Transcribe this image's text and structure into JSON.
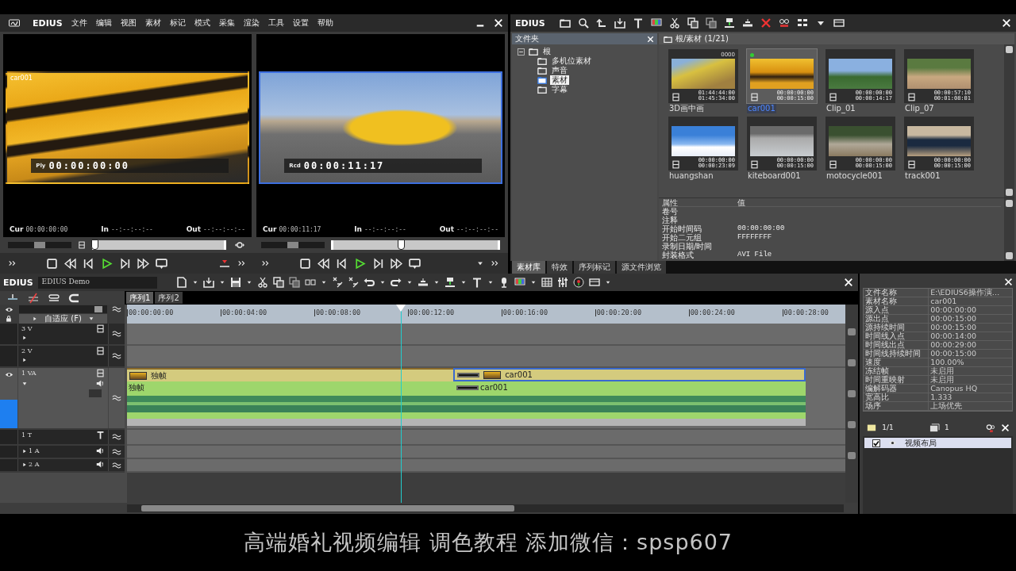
{
  "player_window": {
    "title": "EDIUS",
    "menu": [
      "文件",
      "编辑",
      "视图",
      "素材",
      "标记",
      "模式",
      "采集",
      "渲染",
      "工具",
      "设置",
      "帮助"
    ],
    "monitors": [
      {
        "kind": "player",
        "selected": false,
        "clip_name": "car001",
        "mode": "Ply",
        "timecode": "00:00:00:00",
        "fields": [
          {
            "label": "Cur",
            "value": "00:00:00:00"
          },
          {
            "label": "In",
            "value": "--:--:--:--"
          },
          {
            "label": "Out",
            "value": "--:--:--:--"
          }
        ],
        "shuttle": {
          "level": 0.5
        },
        "level": 0.0
      },
      {
        "kind": "recorder",
        "selected": true,
        "mode": "Rcd",
        "timecode": "00:00:11:17",
        "fields": [
          {
            "label": "Cur",
            "value": "00:00:11:17"
          },
          {
            "label": "In",
            "value": "--:--:--:--"
          },
          {
            "label": "Out",
            "value": "--:--:--:--"
          }
        ],
        "shuttle": {
          "level": 0.5
        },
        "level": 0.41
      }
    ]
  },
  "bin_window": {
    "title": "EDIUS",
    "folder_pane": {
      "title": "文件夹",
      "tree": [
        {
          "label": "根",
          "expanded": true,
          "selected": false,
          "children": [
            {
              "label": "多机位素材",
              "selected": false
            },
            {
              "label": "声音",
              "selected": false
            },
            {
              "label": "素材",
              "selected": true
            },
            {
              "label": "字幕",
              "selected": false
            }
          ]
        }
      ]
    },
    "path": "根/素材 (1/21)",
    "clips": [
      {
        "name": "3D画中画",
        "badge": "0000",
        "in": "01:44:44:00",
        "out": "01:45:34:00",
        "used": false,
        "selected": false
      },
      {
        "name": "car001",
        "in": "00:00:00:00",
        "out": "00:00:15:00",
        "used": true,
        "selected": true
      },
      {
        "name": "Clip_01",
        "in": "00:00:00:00",
        "out": "00:00:14:17",
        "used": false,
        "selected": false
      },
      {
        "name": "Clip_07",
        "in": "00:00:57:10",
        "out": "00:01:08:01",
        "used": false,
        "selected": false
      },
      {
        "name": "huangshan",
        "in": "00:00:00:00",
        "out": "00:00:23:09",
        "used": false,
        "selected": false
      },
      {
        "name": "kiteboard001",
        "in": "00:00:00:00",
        "out": "00:00:15:00",
        "used": false,
        "selected": false
      },
      {
        "name": "motocycle001",
        "in": "00:00:00:00",
        "out": "00:00:15:00",
        "used": false,
        "selected": false
      },
      {
        "name": "track001",
        "in": "00:00:00:00",
        "out": "00:00:15:00",
        "used": false,
        "selected": false
      }
    ],
    "properties": {
      "columns": [
        "属性",
        "值"
      ],
      "rows": [
        {
          "name": "卷号"
        },
        {
          "name": "注释"
        },
        {
          "name": "开始时间码",
          "value": "00:00:00:00"
        },
        {
          "name": "开始二元组",
          "value": "FFFFFFFF"
        },
        {
          "name": "录制日期/时间"
        },
        {
          "name": "封装格式",
          "value": "AVI File"
        }
      ]
    },
    "tabs": [
      {
        "label": "素材库",
        "selected": true
      },
      {
        "label": "特效",
        "selected": false
      },
      {
        "label": "序列标记",
        "selected": false
      },
      {
        "label": "源文件浏览",
        "selected": false
      }
    ]
  },
  "timeline": {
    "title": "EDIUS",
    "project": "EDIUS Demo",
    "sequences": [
      {
        "label": "序列1",
        "selected": true
      },
      {
        "label": "序列2",
        "selected": false
      }
    ],
    "zoom": "自适应 (F)",
    "zoom_slider": {
      "level": 0.95
    },
    "ruler": [
      "00:00:00:00",
      "00:00:04:00",
      "00:00:08:00",
      "00:00:12:00",
      "00:00:16:00",
      "00:00:20:00",
      "00:00:24:00",
      "00:00:28:00"
    ],
    "playhead": {
      "level": 0.381
    },
    "tracks": [
      {
        "label": "3 V",
        "kind": "video",
        "patched": false
      },
      {
        "label": "2 V",
        "kind": "video",
        "patched": false
      },
      {
        "label": "1 VA",
        "kind": "va",
        "patched": true,
        "video_clips": [
          {
            "name": "独帧",
            "selected": false
          },
          {
            "name": "car001",
            "selected": true
          }
        ],
        "audio_clips": [
          {
            "name": "独帧"
          },
          {
            "name": "car001"
          }
        ]
      },
      {
        "label": "1 T",
        "kind": "title",
        "patched": false
      },
      {
        "label": "1 A",
        "kind": "audio",
        "patched": false
      },
      {
        "label": "2 A",
        "kind": "audio",
        "patched": false
      }
    ]
  },
  "info_panel": {
    "rows": [
      {
        "name": "文件名称",
        "value": "E:\\EDIUS6操作演…"
      },
      {
        "name": "素材名称",
        "value": "car001"
      },
      {
        "name": "源入点",
        "value": "00:00:00:00"
      },
      {
        "name": "源出点",
        "value": "00:00:15:00"
      },
      {
        "name": "源持续时间",
        "value": "00:00:15:00"
      },
      {
        "name": "时间线入点",
        "value": "00:00:14:00"
      },
      {
        "name": "时间线出点",
        "value": "00:00:29:00"
      },
      {
        "name": "时间线持续时间",
        "value": "00:00:15:00"
      },
      {
        "name": "速度",
        "value": "100.00%"
      },
      {
        "name": "冻结帧",
        "value": "未启用"
      },
      {
        "name": "时间重映射",
        "value": "未启用"
      },
      {
        "name": "编解码器",
        "value": "Canopus HQ"
      },
      {
        "name": "宽高比",
        "value": "1.333"
      },
      {
        "name": "场序",
        "value": "上场优先"
      }
    ],
    "layers": {
      "page": "1/1",
      "count": "1",
      "items": [
        {
          "label": "视频布局",
          "checked": true
        }
      ]
    }
  },
  "caption": "高端婚礼视频编辑 调色教程 添加微信：spsp607"
}
